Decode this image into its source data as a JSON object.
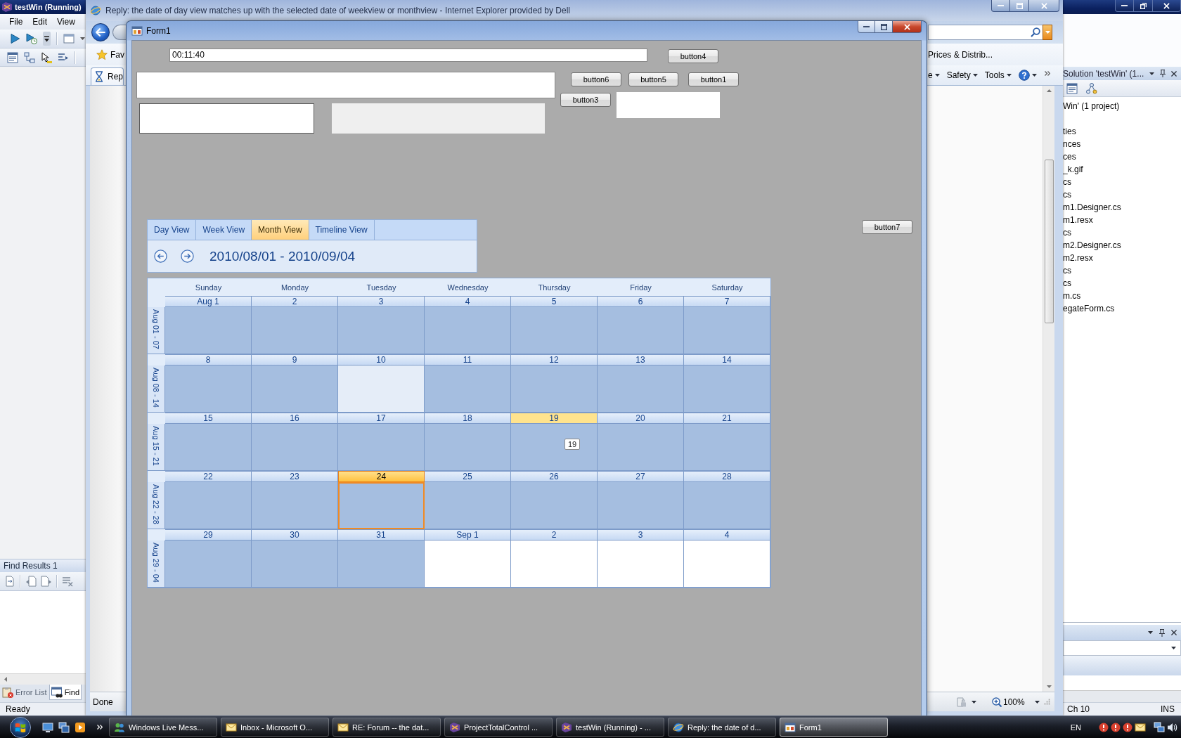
{
  "vs_window": {
    "title": "testWin (Running)",
    "menu": [
      "File",
      "Edit",
      "View"
    ],
    "find_results": {
      "title": "Find Results 1",
      "tabs": [
        {
          "label": "Error List",
          "selected": false
        },
        {
          "label": "Find",
          "selected": true
        }
      ]
    },
    "solution_explorer": {
      "title": "Solution 'testWin' (1...",
      "items": [
        "Win' (1 project)",
        "ties",
        "nces",
        "ces",
        "_k.gif",
        "cs",
        "cs",
        "m1.Designer.cs",
        "m1.resx",
        "cs",
        "m2.Designer.cs",
        "m2.resx",
        "cs",
        "cs",
        "m.cs",
        "egateForm.cs"
      ]
    },
    "status_bar": {
      "message": "Ready",
      "column": "Ch 10",
      "mode": "INS"
    }
  },
  "ie_window": {
    "title": "Reply: the date of day view matches up with the selected date of weekview or monthview - Internet Explorer provided by Dell",
    "favorites": "Fav",
    "favorite_link": "Prices & Distrib...",
    "tab": "Rep",
    "commands": [
      "e",
      "Safety",
      "Tools"
    ],
    "status": "Done",
    "zoom": "100%"
  },
  "form1": {
    "title": "Form1",
    "time_field": {
      "value": "00:11:40"
    },
    "buttons": [
      "button4",
      "button6",
      "button5",
      "button1",
      "button3",
      "button7"
    ],
    "text_fields": [
      {
        "disabled": false
      },
      {
        "disabled": false
      },
      {
        "disabled": true
      },
      {
        "disabled": false
      }
    ],
    "calendar": {
      "tabs": [
        {
          "label": "Day View",
          "selected": false
        },
        {
          "label": "Week View",
          "selected": false
        },
        {
          "label": "Month View",
          "selected": true
        },
        {
          "label": "Timeline View",
          "selected": false
        }
      ],
      "date_range": "2010/08/01 - 2010/09/04",
      "weekdays": [
        "Sunday",
        "Monday",
        "Tuesday",
        "Wednesday",
        "Thursday",
        "Friday",
        "Saturday"
      ],
      "weeks": [
        {
          "label": "Aug 01 - 07",
          "days": [
            {
              "date": "Aug 1",
              "selected": false,
              "today": false,
              "highlighted": false,
              "other_month": false
            },
            {
              "date": "2",
              "selected": false,
              "today": false,
              "highlighted": false,
              "other_month": false
            },
            {
              "date": "3",
              "selected": false,
              "today": false,
              "highlighted": false,
              "other_month": false
            },
            {
              "date": "4",
              "selected": false,
              "today": false,
              "highlighted": false,
              "other_month": false
            },
            {
              "date": "5",
              "selected": false,
              "today": false,
              "highlighted": false,
              "other_month": false
            },
            {
              "date": "6",
              "selected": false,
              "today": false,
              "highlighted": false,
              "other_month": false
            },
            {
              "date": "7",
              "selected": false,
              "today": false,
              "highlighted": false,
              "other_month": false
            }
          ]
        },
        {
          "label": "Aug 08 - 14",
          "days": [
            {
              "date": "8",
              "selected": false,
              "today": false,
              "highlighted": false,
              "other_month": false
            },
            {
              "date": "9",
              "selected": false,
              "today": false,
              "highlighted": false,
              "other_month": false
            },
            {
              "date": "10",
              "selected": true,
              "today": false,
              "highlighted": false,
              "other_month": false
            },
            {
              "date": "11",
              "selected": false,
              "today": false,
              "highlighted": false,
              "other_month": false
            },
            {
              "date": "12",
              "selected": false,
              "today": false,
              "highlighted": false,
              "other_month": false
            },
            {
              "date": "13",
              "selected": false,
              "today": false,
              "highlighted": false,
              "other_month": false
            },
            {
              "date": "14",
              "selected": false,
              "today": false,
              "highlighted": false,
              "other_month": false
            }
          ]
        },
        {
          "label": "Aug 15 - 21",
          "days": [
            {
              "date": "15",
              "selected": false,
              "today": false,
              "highlighted": false,
              "other_month": false
            },
            {
              "date": "16",
              "selected": false,
              "today": false,
              "highlighted": false,
              "other_month": false
            },
            {
              "date": "17",
              "selected": false,
              "today": false,
              "highlighted": false,
              "other_month": false
            },
            {
              "date": "18",
              "selected": false,
              "today": false,
              "highlighted": false,
              "other_month": false
            },
            {
              "date": "19",
              "selected": false,
              "today": false,
              "highlighted": true,
              "other_month": false,
              "tooltip": "19"
            },
            {
              "date": "20",
              "selected": false,
              "today": false,
              "highlighted": false,
              "other_month": false
            },
            {
              "date": "21",
              "selected": false,
              "today": false,
              "highlighted": false,
              "other_month": false
            }
          ]
        },
        {
          "label": "Aug 22 - 28",
          "days": [
            {
              "date": "22",
              "selected": false,
              "today": false,
              "highlighted": false,
              "other_month": false
            },
            {
              "date": "23",
              "selected": false,
              "today": false,
              "highlighted": false,
              "other_month": false
            },
            {
              "date": "24",
              "selected": false,
              "today": true,
              "highlighted": false,
              "other_month": false
            },
            {
              "date": "25",
              "selected": false,
              "today": false,
              "highlighted": false,
              "other_month": false
            },
            {
              "date": "26",
              "selected": false,
              "today": false,
              "highlighted": false,
              "other_month": false
            },
            {
              "date": "27",
              "selected": false,
              "today": false,
              "highlighted": false,
              "other_month": false
            },
            {
              "date": "28",
              "selected": false,
              "today": false,
              "highlighted": false,
              "other_month": false
            }
          ]
        },
        {
          "label": "Aug 29 - 04",
          "days": [
            {
              "date": "29",
              "selected": false,
              "today": false,
              "highlighted": false,
              "other_month": false
            },
            {
              "date": "30",
              "selected": false,
              "today": false,
              "highlighted": false,
              "other_month": false
            },
            {
              "date": "31",
              "selected": false,
              "today": false,
              "highlighted": false,
              "other_month": false
            },
            {
              "date": "Sep 1",
              "selected": false,
              "today": false,
              "highlighted": false,
              "other_month": true
            },
            {
              "date": "2",
              "selected": false,
              "today": false,
              "highlighted": false,
              "other_month": true
            },
            {
              "date": "3",
              "selected": false,
              "today": false,
              "highlighted": false,
              "other_month": true
            },
            {
              "date": "4",
              "selected": false,
              "today": false,
              "highlighted": false,
              "other_month": true
            }
          ]
        }
      ]
    }
  },
  "taskbar": {
    "tasks": [
      {
        "label": "Windows Live Mess...",
        "selected": false
      },
      {
        "label": "Inbox - Microsoft O...",
        "selected": false
      },
      {
        "label": "RE: Forum -- the dat...",
        "selected": false
      },
      {
        "label": "ProjectTotalControl ...",
        "selected": false
      },
      {
        "label": "testWin (Running) - ...",
        "selected": false
      },
      {
        "label": "Reply: the date of d...",
        "selected": false
      },
      {
        "label": "Form1",
        "selected": true
      }
    ],
    "language": "EN"
  }
}
